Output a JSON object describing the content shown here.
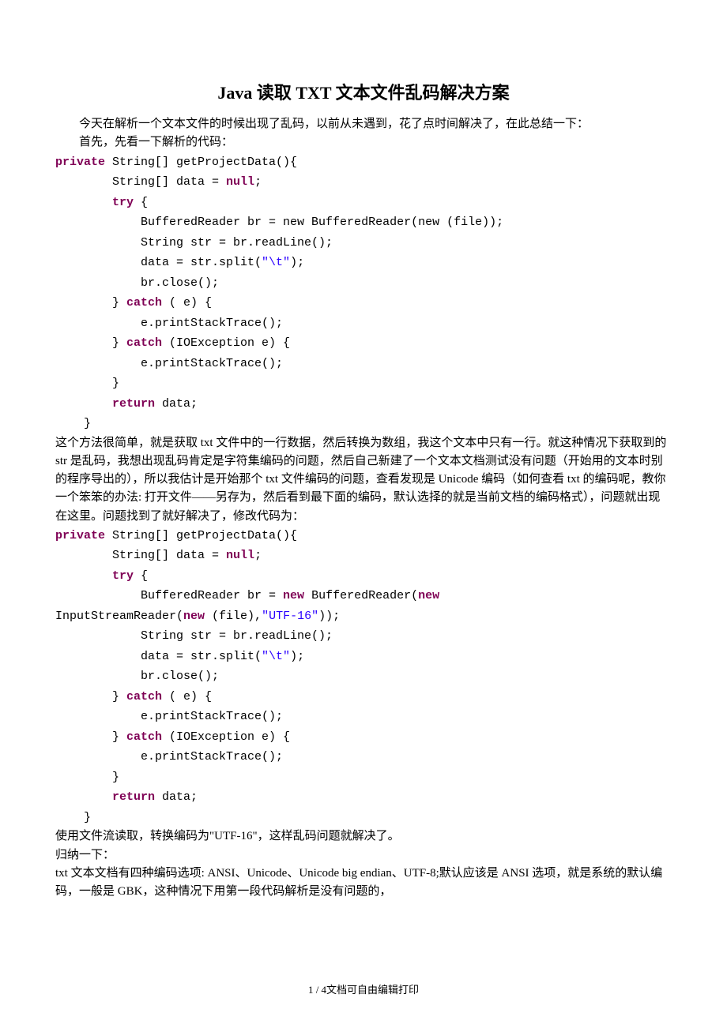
{
  "title": "Java 读取 TXT 文本文件乱码解决方案",
  "p1": "今天在解析一个文本文件的时候出现了乱码，以前从未遇到，花了点时间解决了，在此总结一下：",
  "p2": "首先，先看一下解析的代码：",
  "code1": {
    "kw_private": "private",
    "sig": " String[] getProjectData(){",
    "l1a": "        String[] data = ",
    "kw_null1": "null",
    "l1b": ";",
    "l2a": "        ",
    "kw_try1": "try",
    "l2b": " {",
    "l3": "            BufferedReader br = new BufferedReader(new (file));",
    "l4": "            String str = br.readLine();",
    "l5a": "            data = str.split(",
    "str_t1": "\"\\t\"",
    "l5b": ");",
    "l6": "            br.close();",
    "l7a": "        } ",
    "kw_catch1": "catch",
    "l7b": " ( e) {",
    "l8": "            e.printStackTrace();",
    "l9a": "        } ",
    "kw_catch2": "catch",
    "l9b": " (IOException e) {",
    "l10": "            e.printStackTrace();",
    "l11": "        }",
    "l12a": "        ",
    "kw_return1": "return",
    "l12b": " data;",
    "l13": "    }"
  },
  "p3": "这个方法很简单，就是获取 txt 文件中的一行数据，然后转换为数组，我这个文本中只有一行。就这种情况下获取到的 str 是乱码，我想出现乱码肯定是字符集编码的问题，然后自己新建了一个文本文档测试没有问题（开始用的文本时别的程序导出的），所以我估计是开始那个 txt 文件编码的问题，查看发现是 Unicode 编码（如何查看 txt 的编码呢，教你一个笨笨的办法: 打开文件——另存为，然后看到最下面的编码，默认选择的就是当前文档的编码格式），问题就出现在这里。问题找到了就好解决了，修改代码为：",
  "code2": {
    "kw_private": "private",
    "sig": " String[] getProjectData(){",
    "l1a": "        String[] data = ",
    "kw_null1": "null",
    "l1b": ";",
    "l2a": "        ",
    "kw_try1": "try",
    "l2b": " {",
    "l3a": "            BufferedReader br = ",
    "kw_new1": "new",
    "l3b": " BufferedReader(",
    "kw_new2": "new",
    "l3c": " ",
    "l3d": "InputStreamReader(",
    "kw_new3": "new",
    "l3e": " (file),",
    "str_utf": "\"UTF-16\"",
    "l3f": "));",
    "l4": "            String str = br.readLine();",
    "l5a": "            data = str.split(",
    "str_t1": "\"\\t\"",
    "l5b": ");",
    "l6": "            br.close();",
    "l7a": "        } ",
    "kw_catch1": "catch",
    "l7b": " ( e) {",
    "l8": "            e.printStackTrace();",
    "l9a": "        } ",
    "kw_catch2": "catch",
    "l9b": " (IOException e) {",
    "l10": "            e.printStackTrace();",
    "l11": "        }",
    "l12a": "        ",
    "kw_return1": "return",
    "l12b": " data;",
    "l13": "    }"
  },
  "p4": "使用文件流读取，转换编码为\"UTF-16\"，这样乱码问题就解决了。",
  "p5": "归纳一下：",
  "p6": "txt 文本文档有四种编码选项: ANSI、Unicode、Unicode big endian、UTF-8;默认应该是 ANSI 选项，就是系统的默认编码，一般是 GBK，这种情况下用第一段代码解析是没有问题的，",
  "footer": "1 / 4文档可自由编辑打印"
}
